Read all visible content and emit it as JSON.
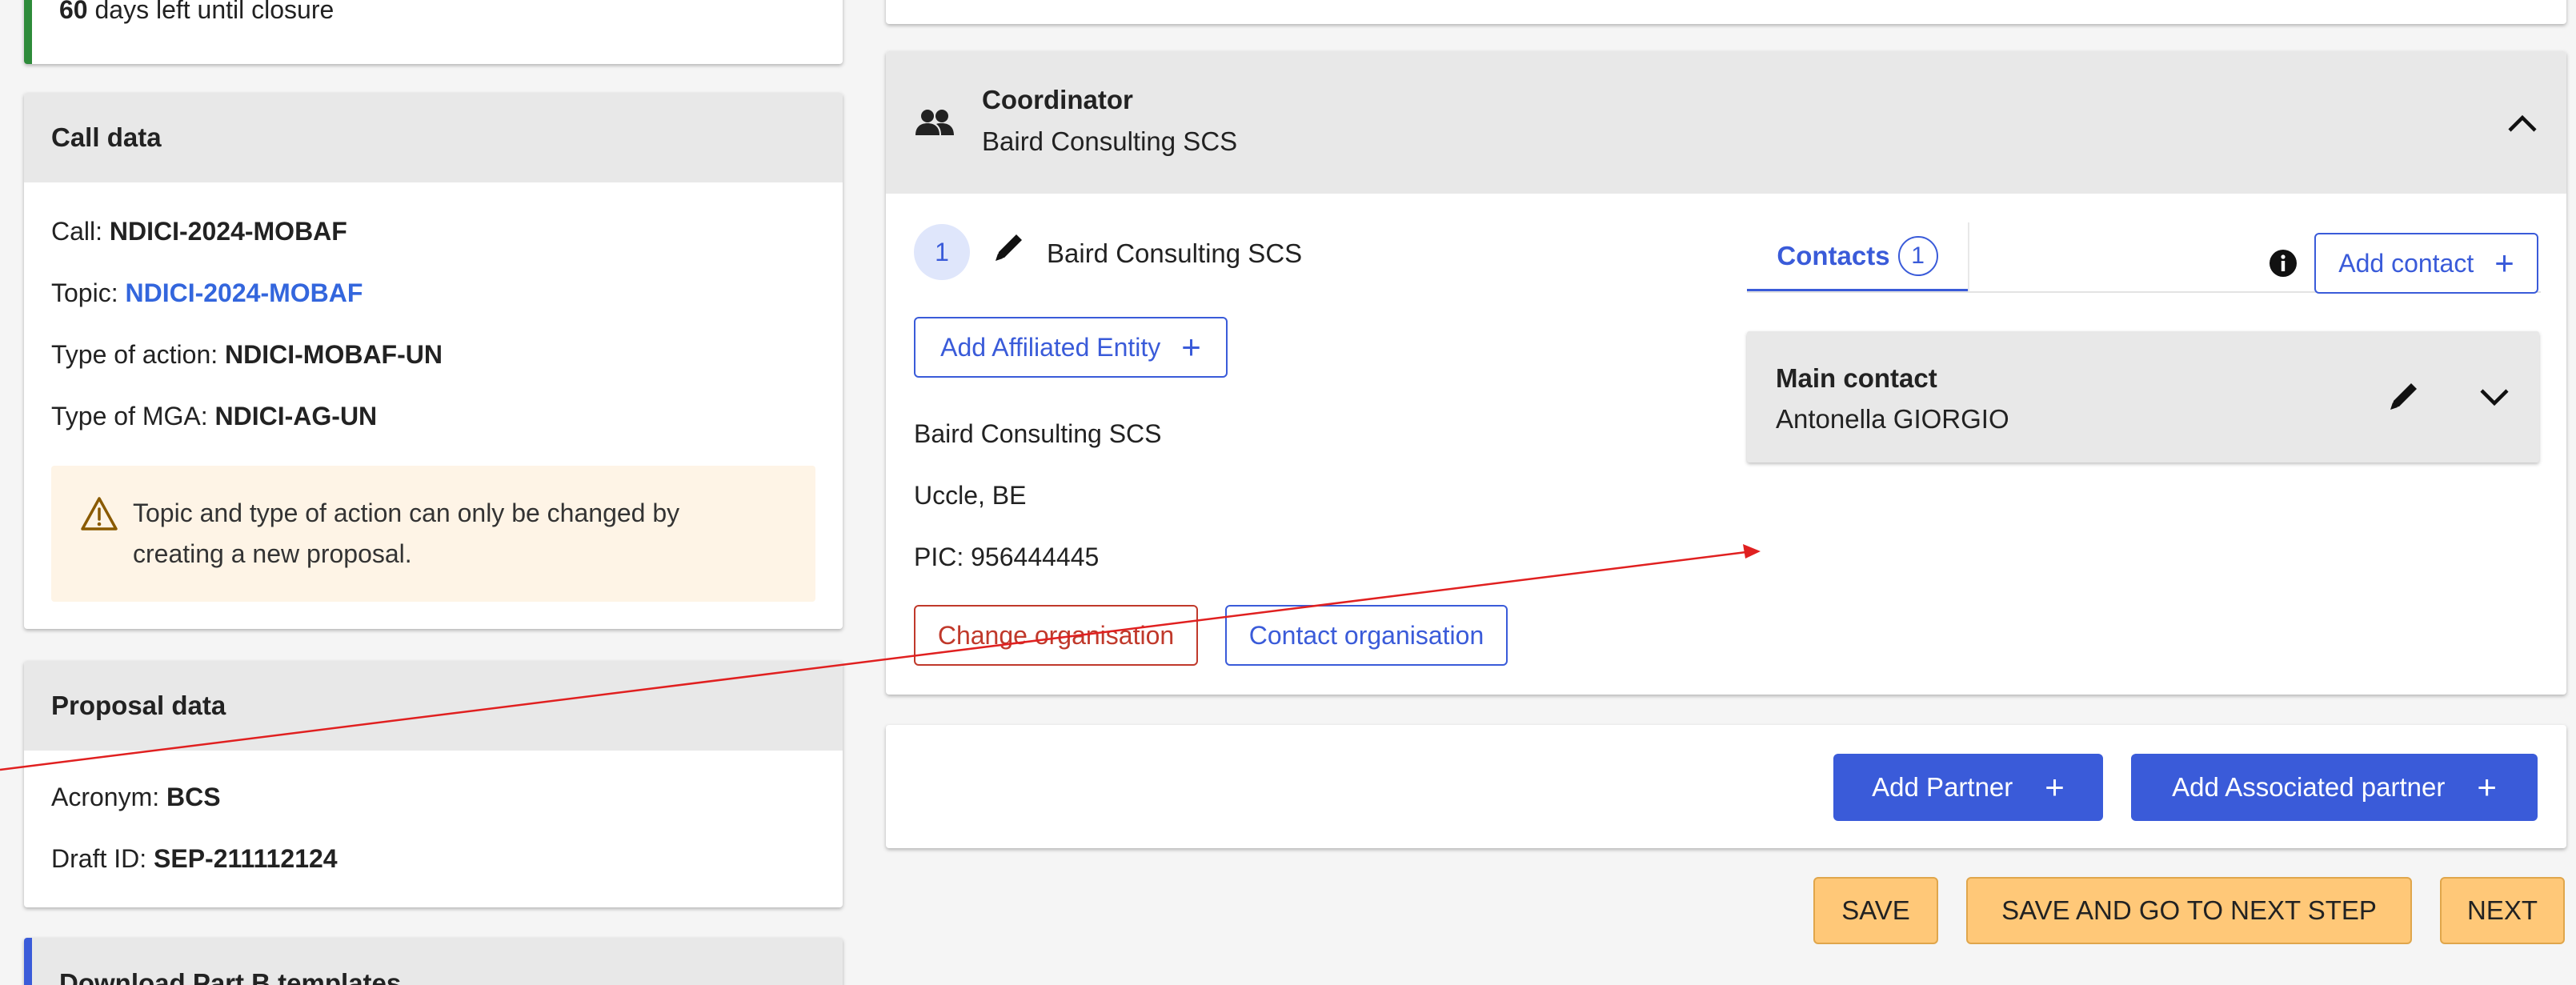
{
  "left": {
    "closure_card": {
      "days": "60",
      "text": " days left until closure"
    },
    "call_card": {
      "title": "Call data",
      "call_label": "Call: ",
      "call_value": "NDICI-2024-MOBAF",
      "topic_label": "Topic:  ",
      "topic_value": "NDICI-2024-MOBAF",
      "action_label": "Type of action: ",
      "action_value": "NDICI-MOBAF-UN",
      "mga_label": "Type of MGA: ",
      "mga_value": "NDICI-AG-UN",
      "warning": "Topic and type of action can only be changed by creating a new proposal."
    },
    "proposal_card": {
      "title": "Proposal data",
      "acronym_label": "Acronym: ",
      "acronym_value": "BCS",
      "draft_label": "Draft ID: ",
      "draft_value": "SEP-211112124"
    },
    "download_card": {
      "title": "Download Part B templates"
    }
  },
  "coordinator": {
    "role": "Coordinator",
    "org_name": "Baird Consulting SCS",
    "number": "1",
    "entity_name": "Baird Consulting SCS",
    "add_affiliated": "Add Affiliated Entity",
    "address_name": "Baird Consulting SCS",
    "address_city": "Uccle, BE",
    "pic": "PIC: 956444445",
    "change_org": "Change organisation",
    "contact_org": "Contact organisation",
    "contacts_tab": "Contacts",
    "contacts_count": "1",
    "add_contact": "Add contact",
    "main_contact_title": "Main contact",
    "main_contact_name": "Antonella GIORGIO"
  },
  "partners": {
    "add_partner": "Add Partner",
    "add_associated": "Add Associated partner"
  },
  "footer": {
    "save": "SAVE",
    "save_next": "SAVE AND GO TO NEXT STEP",
    "next": "NEXT"
  },
  "colors": {
    "accent": "#3a5bd9",
    "danger": "#c0392b",
    "warning_bg": "#fef4e6",
    "amber": "#ffc878",
    "green_bar": "#2e8b3a",
    "annotation": "#e02020"
  }
}
